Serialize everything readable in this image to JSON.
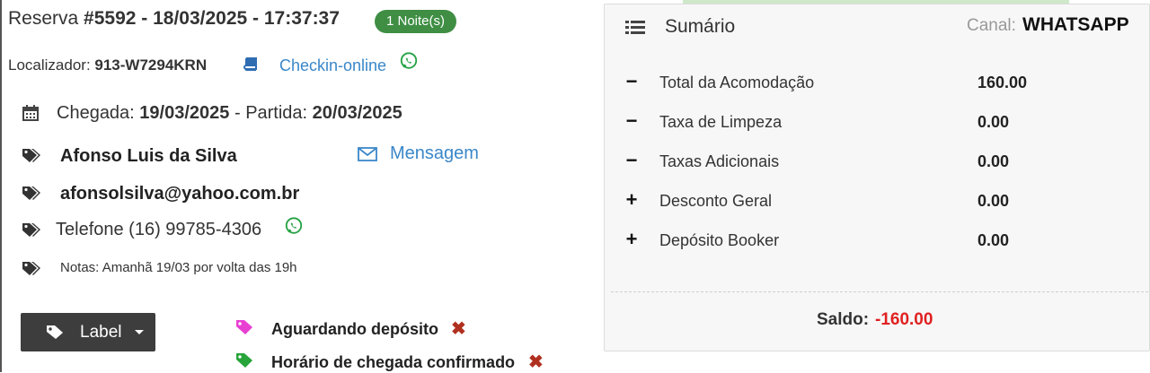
{
  "reservation": {
    "title_prefix": "Reserva ",
    "title_bold": "#5592 - 18/03/2025 - 17:37:37",
    "nights_badge": "1 Noite(s)",
    "locator_label": "Localizador: ",
    "locator_value": "913-W7294KRN",
    "checkin_link": "Checkin-online",
    "arrival_label": "Chegada: ",
    "arrival_value": "19/03/2025",
    "dash": " - ",
    "departure_label": "Partida: ",
    "departure_value": "20/03/2025"
  },
  "guest": {
    "name": "Afonso Luis da Silva",
    "message_link": "Mensagem",
    "email": "afonsolsilva@yahoo.com.br",
    "phone": "Telefone (16) 99785-4306",
    "notes": "Notas: Amanhã 19/03 por volta das 19h"
  },
  "labels": {
    "button": "Label",
    "items": [
      {
        "text": "Aguardando depósito",
        "color": "#e83fd3"
      },
      {
        "text": "Horário de chegada confirmado",
        "color": "#27a43a"
      }
    ],
    "remove_glyph": "✖"
  },
  "summary": {
    "title": "Sumário",
    "canal_label": "Canal: ",
    "canal_value": "WHATSAPP",
    "items": [
      {
        "sign": "−",
        "label": "Total da Acomodação",
        "value": "160.00"
      },
      {
        "sign": "−",
        "label": "Taxa de Limpeza",
        "value": "0.00"
      },
      {
        "sign": "−",
        "label": "Taxas Adicionais",
        "value": "0.00"
      },
      {
        "sign": "+",
        "label": "Desconto Geral",
        "value": "0.00"
      },
      {
        "sign": "+",
        "label": "Depósito Booker",
        "value": "0.00"
      }
    ],
    "saldo_label": "Saldo: ",
    "saldo_value": "-160.00"
  },
  "colors": {
    "badge_green": "#3f8e44",
    "link_blue": "#3a87c9",
    "whatsapp_green": "#25a244",
    "remove_red": "#b0301f",
    "saldo_red": "#e02020"
  },
  "icons": [
    "book-icon",
    "whatsapp-icon",
    "calendar-icon",
    "tag-icon",
    "envelope-icon",
    "list-icon",
    "remove-icon"
  ]
}
